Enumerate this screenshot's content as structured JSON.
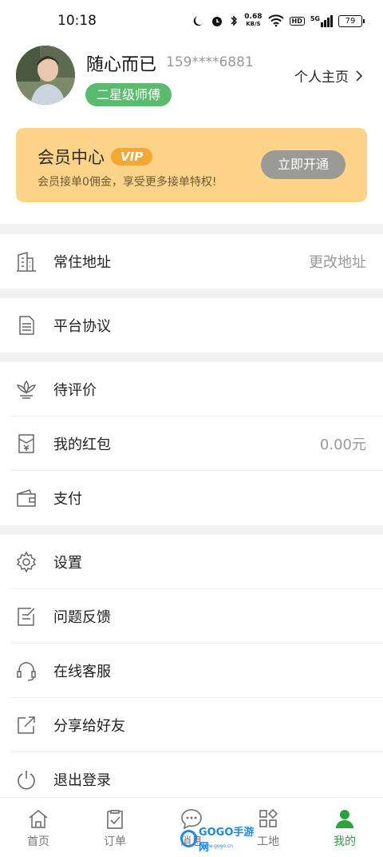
{
  "status_bar": {
    "time": "10:18",
    "speed_value": "0.68",
    "speed_unit": "KB/S",
    "hd": "HD",
    "signal": "5G",
    "battery": "79"
  },
  "profile": {
    "name": "随心而已",
    "phone": "159****6881",
    "level": "二星级师傅",
    "homepage_label": "个人主页"
  },
  "vip": {
    "title": "会员中心",
    "badge": "VIP",
    "subtitle": "会员接单0佣金，享受更多接单特权!",
    "button": "立即开通"
  },
  "menu": {
    "address": {
      "label": "常住地址",
      "value": "更改地址",
      "icon": "building-icon"
    },
    "agreement": {
      "label": "平台协议",
      "icon": "document-icon"
    },
    "review": {
      "label": "待评价",
      "icon": "flower-icon"
    },
    "red_packet": {
      "label": "我的红包",
      "value": "0.00元",
      "icon": "red-packet-icon"
    },
    "payment": {
      "label": "支付",
      "icon": "wallet-icon"
    },
    "settings": {
      "label": "设置",
      "icon": "gear-icon"
    },
    "feedback": {
      "label": "问题反馈",
      "icon": "edit-note-icon"
    },
    "support": {
      "label": "在线客服",
      "icon": "headset-icon"
    },
    "share": {
      "label": "分享给好友",
      "icon": "share-icon"
    },
    "logout": {
      "label": "退出登录",
      "icon": "power-icon"
    }
  },
  "tabs": [
    {
      "label": "首页",
      "icon": "home-icon"
    },
    {
      "label": "订单",
      "icon": "clipboard-icon"
    },
    {
      "label": "消息",
      "icon": "chat-icon"
    },
    {
      "label": "工地",
      "icon": "grid-icon"
    },
    {
      "label": "我的",
      "icon": "person-icon"
    }
  ],
  "watermark": {
    "text": "GOGO手游网",
    "sub": "www.gogo.cn"
  },
  "colors": {
    "accent_green": "#2aa33c",
    "badge_green": "#5cba6e",
    "vip_bg": "#fdd389",
    "vip_badge": "#f3a734"
  }
}
